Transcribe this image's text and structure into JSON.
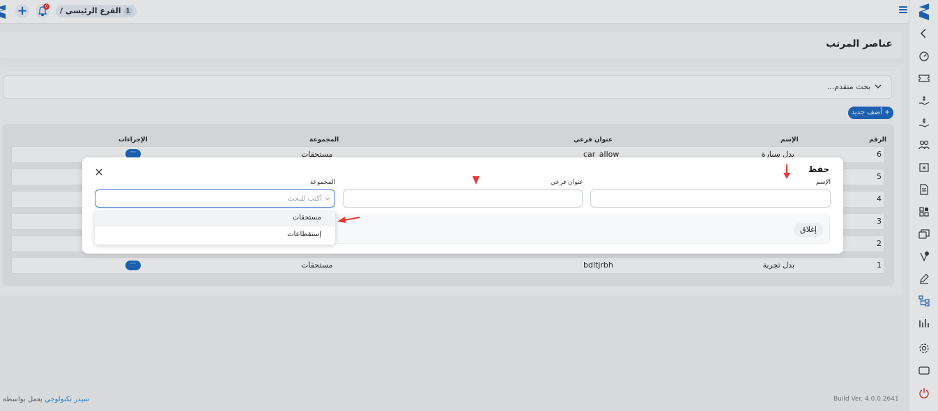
{
  "topbar": {
    "branch_label": "الفرع الرئيسي /",
    "branch_number": "1",
    "notification_count": "0"
  },
  "page": {
    "title": "عناصر المرتب",
    "advanced_search": "بحث متقدم...",
    "add_new": "+ أضف جديد"
  },
  "table": {
    "headers": {
      "number": "الرقم",
      "name": "الإسم",
      "subtitle": "عنوان فرعي",
      "group": "المجموعة",
      "actions": "الإجراءات"
    },
    "rows": [
      {
        "num": "6",
        "name": "بدل سيارة",
        "subtitle": "car_allow",
        "group": "مستحقات"
      },
      {
        "num": "5"
      },
      {
        "num": "4"
      },
      {
        "num": "3"
      },
      {
        "num": "2"
      },
      {
        "num": "1",
        "name": "بدل تجربة",
        "subtitle": "bdltjrbh",
        "group": "مستحقات"
      }
    ],
    "action_label": "···"
  },
  "modal": {
    "title": "حفظ",
    "name_label": "الإسم",
    "subtitle_label": "عنوان فرعي",
    "group_label": "المجموعة",
    "group_placeholder": "أكتب للبحث",
    "close_button": "إغلاق"
  },
  "dropdown": {
    "options": [
      "مستحقات",
      "إستقطاعات"
    ],
    "selected": "مستحقات"
  },
  "footer": {
    "powered_prefix": "يعمل بواسطة",
    "powered_brand": "سيدر تكنولوجي",
    "build": "Build Ver. 4.0.0.2641"
  },
  "colors": {
    "primary": "#1565c0",
    "annotation": "#e53935"
  }
}
